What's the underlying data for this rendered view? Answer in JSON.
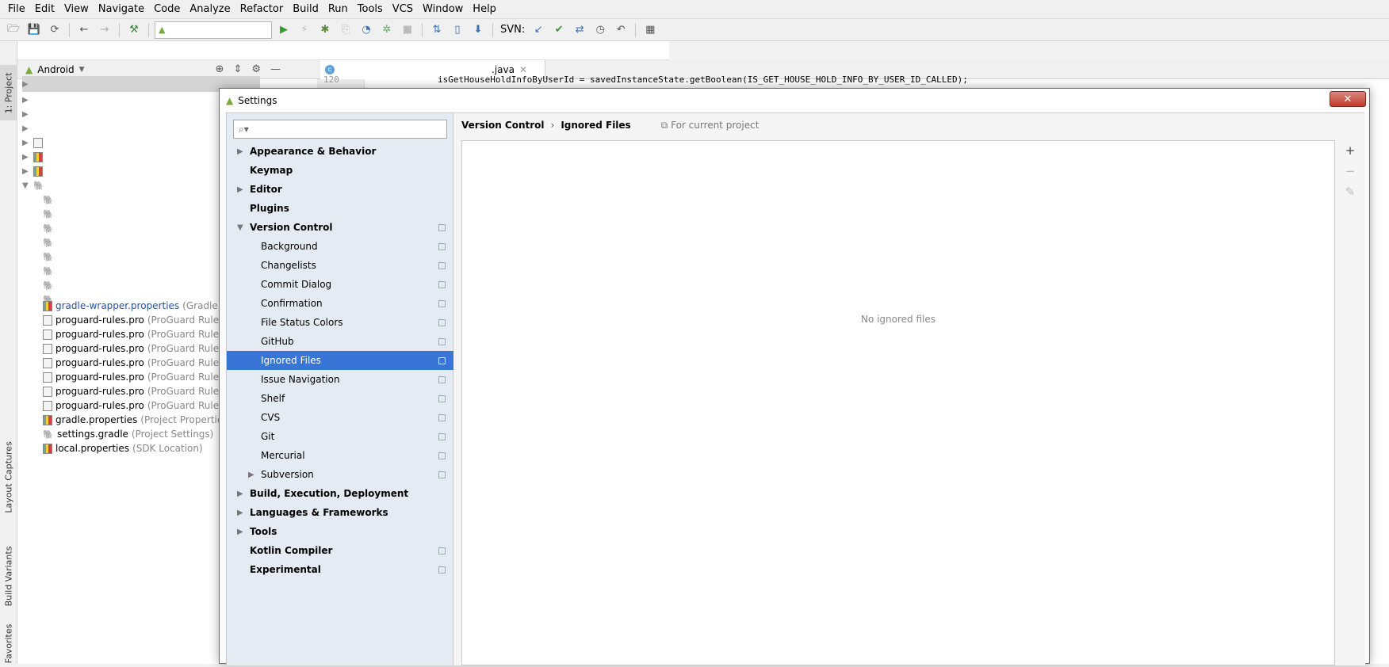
{
  "menubar": [
    "File",
    "Edit",
    "View",
    "Navigate",
    "Code",
    "Analyze",
    "Refactor",
    "Build",
    "Run",
    "Tools",
    "VCS",
    "Window",
    "Help"
  ],
  "toolbar": {
    "svn_label": "SVN:"
  },
  "left_strip": {
    "project": "1: Project",
    "layout_captures": "Layout Captures",
    "build_variants": "Build Variants",
    "favorites": "Favorites"
  },
  "project_panel": {
    "view": "Android",
    "files": [
      {
        "name": "gradle-wrapper.properties",
        "hint": "(Gradle Ver",
        "icon": "properties"
      },
      {
        "name": "proguard-rules.pro",
        "hint": "(ProGuard Rules fo",
        "icon": "file"
      },
      {
        "name": "proguard-rules.pro",
        "hint": "(ProGuard Rules fo",
        "icon": "file"
      },
      {
        "name": "proguard-rules.pro",
        "hint": "(ProGuard Rules fo",
        "icon": "file"
      },
      {
        "name": "proguard-rules.pro",
        "hint": "(ProGuard Rules fo",
        "icon": "file"
      },
      {
        "name": "proguard-rules.pro",
        "hint": "(ProGuard Rules fo",
        "icon": "file"
      },
      {
        "name": "proguard-rules.pro",
        "hint": "(ProGuard Rules fo",
        "icon": "file"
      },
      {
        "name": "proguard-rules.pro",
        "hint": "(ProGuard Rules fo",
        "icon": "file"
      },
      {
        "name": "gradle.properties",
        "hint": "(Project Properties)",
        "icon": "properties"
      },
      {
        "name": "settings.gradle",
        "hint": "(Project Settings)",
        "icon": "gradle"
      },
      {
        "name": "local.properties",
        "hint": "(SDK Location)",
        "icon": "properties"
      }
    ]
  },
  "editor": {
    "tab": ".java",
    "lines": [
      {
        "num": "120",
        "text": "isGetHouseHoldInfoByUserId = savedInstanceState.getBoolean(IS_GET_HOUSE_HOLD_INFO_BY_USER_ID_CALLED);"
      }
    ]
  },
  "dialog": {
    "title": "Settings",
    "close": "✕",
    "search_placeholder": "",
    "sidebar": [
      {
        "label": "Appearance & Behavior",
        "level": 0,
        "bold": true,
        "expander": "▶",
        "proj": false
      },
      {
        "label": "Keymap",
        "level": 0,
        "bold": true,
        "expander": "",
        "proj": false
      },
      {
        "label": "Editor",
        "level": 0,
        "bold": true,
        "expander": "▶",
        "proj": false
      },
      {
        "label": "Plugins",
        "level": 0,
        "bold": true,
        "expander": "",
        "proj": false
      },
      {
        "label": "Version Control",
        "level": 0,
        "bold": false,
        "expander": "▼",
        "proj": true
      },
      {
        "label": "Background",
        "level": 1,
        "bold": false,
        "expander": "",
        "proj": true
      },
      {
        "label": "Changelists",
        "level": 1,
        "bold": false,
        "expander": "",
        "proj": true
      },
      {
        "label": "Commit Dialog",
        "level": 1,
        "bold": false,
        "expander": "",
        "proj": true
      },
      {
        "label": "Confirmation",
        "level": 1,
        "bold": false,
        "expander": "",
        "proj": true
      },
      {
        "label": "File Status Colors",
        "level": 1,
        "bold": false,
        "expander": "",
        "proj": true
      },
      {
        "label": "GitHub",
        "level": 1,
        "bold": false,
        "expander": "",
        "proj": true
      },
      {
        "label": "Ignored Files",
        "level": 1,
        "bold": false,
        "expander": "",
        "proj": true,
        "selected": true
      },
      {
        "label": "Issue Navigation",
        "level": 1,
        "bold": false,
        "expander": "",
        "proj": true
      },
      {
        "label": "Shelf",
        "level": 1,
        "bold": false,
        "expander": "",
        "proj": true
      },
      {
        "label": "CVS",
        "level": 1,
        "bold": false,
        "expander": "",
        "proj": true
      },
      {
        "label": "Git",
        "level": 1,
        "bold": false,
        "expander": "",
        "proj": true
      },
      {
        "label": "Mercurial",
        "level": 1,
        "bold": false,
        "expander": "",
        "proj": true
      },
      {
        "label": "Subversion",
        "level": 1,
        "bold": false,
        "expander": "▶",
        "proj": true
      },
      {
        "label": "Build, Execution, Deployment",
        "level": 0,
        "bold": true,
        "expander": "▶",
        "proj": false
      },
      {
        "label": "Languages & Frameworks",
        "level": 0,
        "bold": true,
        "expander": "▶",
        "proj": false
      },
      {
        "label": "Tools",
        "level": 0,
        "bold": true,
        "expander": "▶",
        "proj": false
      },
      {
        "label": "Kotlin Compiler",
        "level": 0,
        "bold": true,
        "expander": "",
        "proj": true
      },
      {
        "label": "Experimental",
        "level": 0,
        "bold": true,
        "expander": "",
        "proj": true
      }
    ],
    "breadcrumb": {
      "parent": "Version Control",
      "separator": "›",
      "current": "Ignored Files",
      "scope": "For current project"
    },
    "empty_text": "No ignored files",
    "tools": {
      "add": "+",
      "remove": "−",
      "edit": "✎"
    }
  },
  "colors": {
    "selection": "#3875d7",
    "sidebar_bg": "#e4ebf2"
  }
}
